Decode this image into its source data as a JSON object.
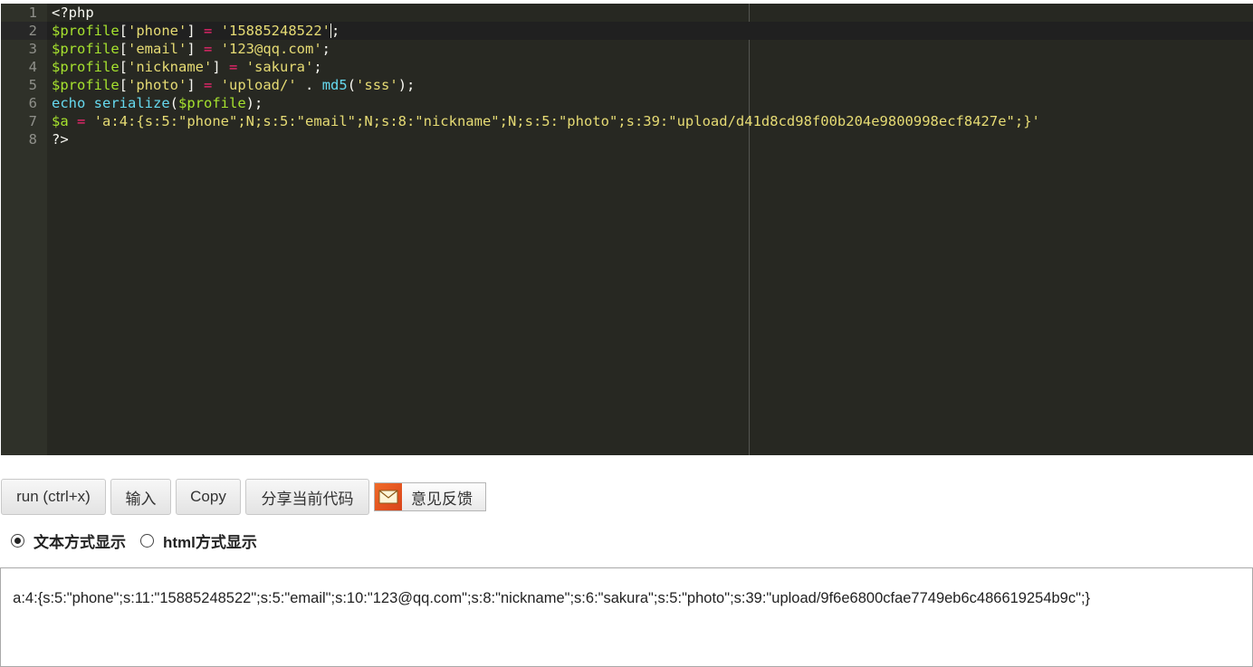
{
  "editor": {
    "active_line": 2,
    "lines": [
      {
        "n": "1",
        "tokens": [
          {
            "t": "<?php",
            "c": "plain"
          }
        ]
      },
      {
        "n": "2",
        "tokens": [
          {
            "t": "$profile",
            "c": "var"
          },
          {
            "t": "[",
            "c": "plain"
          },
          {
            "t": "'phone'",
            "c": "str"
          },
          {
            "t": "] ",
            "c": "plain"
          },
          {
            "t": "=",
            "c": "op"
          },
          {
            "t": " ",
            "c": "plain"
          },
          {
            "t": "'15885248522'",
            "c": "str"
          },
          {
            "t": "|",
            "c": "cursor"
          },
          {
            "t": ";",
            "c": "plain"
          }
        ]
      },
      {
        "n": "3",
        "tokens": [
          {
            "t": "$profile",
            "c": "var"
          },
          {
            "t": "[",
            "c": "plain"
          },
          {
            "t": "'email'",
            "c": "str"
          },
          {
            "t": "] ",
            "c": "plain"
          },
          {
            "t": "=",
            "c": "op"
          },
          {
            "t": " ",
            "c": "plain"
          },
          {
            "t": "'123@qq.com'",
            "c": "str"
          },
          {
            "t": ";",
            "c": "plain"
          }
        ]
      },
      {
        "n": "4",
        "tokens": [
          {
            "t": "$profile",
            "c": "var"
          },
          {
            "t": "[",
            "c": "plain"
          },
          {
            "t": "'nickname'",
            "c": "str"
          },
          {
            "t": "] ",
            "c": "plain"
          },
          {
            "t": "=",
            "c": "op"
          },
          {
            "t": " ",
            "c": "plain"
          },
          {
            "t": "'sakura'",
            "c": "str"
          },
          {
            "t": ";",
            "c": "plain"
          }
        ]
      },
      {
        "n": "5",
        "tokens": [
          {
            "t": "$profile",
            "c": "var"
          },
          {
            "t": "[",
            "c": "plain"
          },
          {
            "t": "'photo'",
            "c": "str"
          },
          {
            "t": "] ",
            "c": "plain"
          },
          {
            "t": "=",
            "c": "op"
          },
          {
            "t": " ",
            "c": "plain"
          },
          {
            "t": "'upload/'",
            "c": "str"
          },
          {
            "t": " . ",
            "c": "plain"
          },
          {
            "t": "md5",
            "c": "fn"
          },
          {
            "t": "(",
            "c": "plain"
          },
          {
            "t": "'sss'",
            "c": "str"
          },
          {
            "t": ");",
            "c": "plain"
          }
        ]
      },
      {
        "n": "6",
        "tokens": [
          {
            "t": "echo",
            "c": "fn"
          },
          {
            "t": " ",
            "c": "plain"
          },
          {
            "t": "serialize",
            "c": "fn"
          },
          {
            "t": "(",
            "c": "plain"
          },
          {
            "t": "$profile",
            "c": "var"
          },
          {
            "t": ");",
            "c": "plain"
          }
        ]
      },
      {
        "n": "7",
        "tokens": [
          {
            "t": "$a",
            "c": "var"
          },
          {
            "t": " ",
            "c": "plain"
          },
          {
            "t": "=",
            "c": "op"
          },
          {
            "t": " ",
            "c": "plain"
          },
          {
            "t": "'a:4:{s:5:\"phone\";N;s:5:\"email\";N;s:8:\"nickname\";N;s:5:\"photo\";s:39:\"upload/d41d8cd98f00b204e9800998ecf8427e\";}'",
            "c": "str"
          }
        ]
      },
      {
        "n": "8",
        "tokens": [
          {
            "t": "?>",
            "c": "plain"
          }
        ]
      }
    ]
  },
  "toolbar": {
    "run_label": "run (ctrl+x)",
    "input_label": "输入",
    "copy_label": "Copy",
    "share_label": "分享当前代码",
    "feedback_label": "意见反馈"
  },
  "display_mode": {
    "text_label": "文本方式显示",
    "html_label": "html方式显示",
    "selected": "text"
  },
  "output": {
    "text": "a:4:{s:5:\"phone\";s:11:\"15885248522\";s:5:\"email\";s:10:\"123@qq.com\";s:8:\"nickname\";s:6:\"sakura\";s:5:\"photo\";s:39:\"upload/9f6e6800cfae7749eb6c486619254b9c\";}"
  },
  "icons": {
    "feedback_icon": "mail-icon"
  }
}
